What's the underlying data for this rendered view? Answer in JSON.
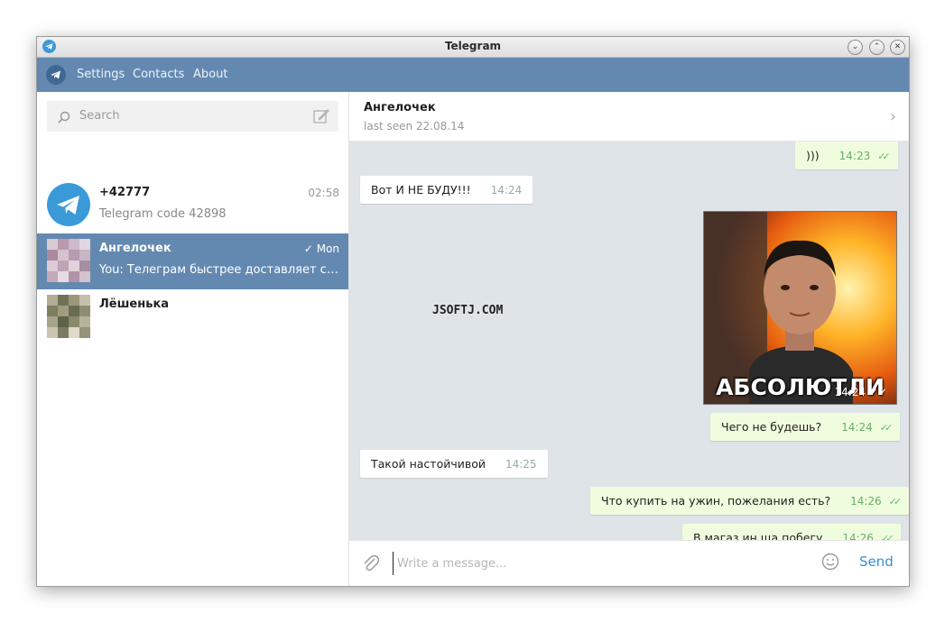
{
  "window": {
    "title": "Telegram"
  },
  "menu": {
    "items": [
      "Settings",
      "Contacts",
      "About"
    ]
  },
  "search": {
    "placeholder": "Search"
  },
  "chats": [
    {
      "name": "+42777",
      "time": "02:58",
      "preview": "Telegram code 42898"
    },
    {
      "name": "Ангелочек",
      "time": "Mon",
      "preview": "You: Телеграм быстрее доставляет сообщения"
    },
    {
      "name": "Лёшенька",
      "time": "",
      "preview": ""
    }
  ],
  "chat_header": {
    "name": "Ангелочек",
    "status": "last seen 22.08.14"
  },
  "messages": [
    {
      "text": ")))",
      "time": "14:23",
      "out": true
    },
    {
      "text": "Вот И НЕ БУДУ!!!",
      "time": "14:24",
      "out": false
    },
    {
      "photo_caption": "АБСОЛЮТЛИ",
      "time": "14:24",
      "out": true
    },
    {
      "text": "Чего не будешь?",
      "time": "14:24",
      "out": true
    },
    {
      "text": "Такой настойчивой",
      "time": "14:25",
      "out": false
    },
    {
      "text": "Что купить на ужин, пожелания есть?",
      "time": "14:26",
      "out": true
    },
    {
      "text": "В магаз ин ща побегу",
      "time": "14:26",
      "out": true
    }
  ],
  "watermark": "JSOFTJ.COM",
  "composer": {
    "placeholder": "Write a message...",
    "send_label": "Send"
  },
  "colors": {
    "header": "#6389b1",
    "chat_bg": "#dfe4e8",
    "out_bubble": "#effdde",
    "accent": "#3c8dd0"
  }
}
